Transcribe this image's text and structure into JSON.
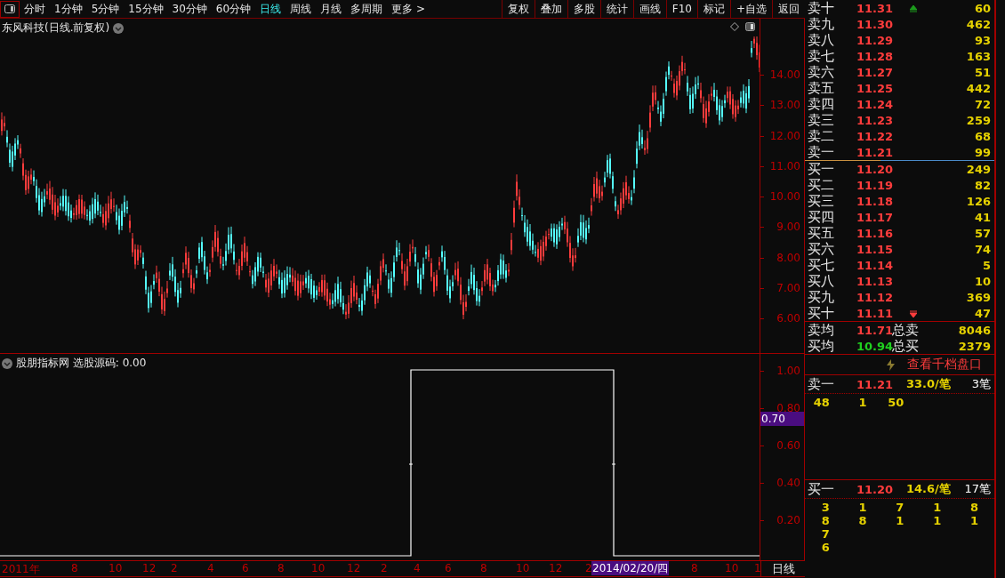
{
  "toolbar": {
    "periods": [
      {
        "label": "分时",
        "selected": false
      },
      {
        "label": "1分钟",
        "selected": false
      },
      {
        "label": "5分钟",
        "selected": false
      },
      {
        "label": "15分钟",
        "selected": false
      },
      {
        "label": "30分钟",
        "selected": false
      },
      {
        "label": "60分钟",
        "selected": false
      },
      {
        "label": "日线",
        "selected": true
      },
      {
        "label": "周线",
        "selected": false
      },
      {
        "label": "月线",
        "selected": false
      },
      {
        "label": "多周期",
        "selected": false
      },
      {
        "label": "更多 >",
        "selected": false
      }
    ],
    "buttons": [
      "复权",
      "叠加",
      "多股",
      "统计",
      "画线",
      "F10",
      "标记",
      "+自选",
      "返回"
    ]
  },
  "main_chart": {
    "title": "东风科技(日线.前复权)",
    "price_ticks": [
      "14.00",
      "13.00",
      "12.00",
      "11.00",
      "10.00",
      "9.00",
      "8.00",
      "7.00",
      "6.00"
    ]
  },
  "indicator": {
    "title": "股朋指标网 选股源码: 0.00",
    "ticks": [
      "1.00",
      "0.80",
      "0.60",
      "0.40",
      "0.20"
    ],
    "current": "0.70"
  },
  "date_axis": {
    "labels": [
      "2011年",
      "8",
      "10",
      "12",
      "2",
      "4",
      "6",
      "8",
      "10",
      "12",
      "2",
      "4",
      "6",
      "8",
      "10",
      "12",
      "2",
      "8",
      "10",
      "1"
    ],
    "cursor_date": "2014/02/20/四",
    "period": "日线"
  },
  "order_book": {
    "asks": [
      {
        "label": "卖十",
        "price": "11.31",
        "volume": "60",
        "up_arrow": true
      },
      {
        "label": "卖九",
        "price": "11.30",
        "volume": "462"
      },
      {
        "label": "卖八",
        "price": "11.29",
        "volume": "93"
      },
      {
        "label": "卖七",
        "price": "11.28",
        "volume": "163"
      },
      {
        "label": "卖六",
        "price": "11.27",
        "volume": "51"
      },
      {
        "label": "卖五",
        "price": "11.25",
        "volume": "442"
      },
      {
        "label": "卖四",
        "price": "11.24",
        "volume": "72"
      },
      {
        "label": "卖三",
        "price": "11.23",
        "volume": "259"
      },
      {
        "label": "卖二",
        "price": "11.22",
        "volume": "68"
      },
      {
        "label": "卖一",
        "price": "11.21",
        "volume": "99"
      }
    ],
    "bids": [
      {
        "label": "买一",
        "price": "11.20",
        "volume": "249"
      },
      {
        "label": "买二",
        "price": "11.19",
        "volume": "82"
      },
      {
        "label": "买三",
        "price": "11.18",
        "volume": "126"
      },
      {
        "label": "买四",
        "price": "11.17",
        "volume": "41"
      },
      {
        "label": "买五",
        "price": "11.16",
        "volume": "57"
      },
      {
        "label": "买六",
        "price": "11.15",
        "volume": "74"
      },
      {
        "label": "买七",
        "price": "11.14",
        "volume": "5"
      },
      {
        "label": "买八",
        "price": "11.13",
        "volume": "10"
      },
      {
        "label": "买九",
        "price": "11.12",
        "volume": "369"
      },
      {
        "label": "买十",
        "price": "11.11",
        "volume": "47",
        "down_arrow": true
      }
    ],
    "averages": [
      {
        "label": "卖均",
        "price": "11.71",
        "up": true,
        "total_label": "总卖",
        "total": "8046"
      },
      {
        "label": "买均",
        "price": "10.94",
        "up": false,
        "total_label": "总买",
        "total": "2379"
      }
    ],
    "depth_link": "查看千档盘口",
    "queues": [
      {
        "label": "卖一",
        "price": "11.21",
        "per_order": "33.0/笔",
        "orders": "3笔",
        "rows": [
          [
            "48",
            "1",
            "50"
          ]
        ]
      },
      {
        "label": "买一",
        "price": "11.20",
        "per_order": "14.6/笔",
        "orders": "17笔",
        "rows": [
          [
            "3",
            "1",
            "7",
            "1",
            "8"
          ],
          [
            "8",
            "8",
            "1",
            "1",
            "1"
          ],
          [
            "7"
          ],
          [
            "6"
          ]
        ]
      }
    ]
  }
}
